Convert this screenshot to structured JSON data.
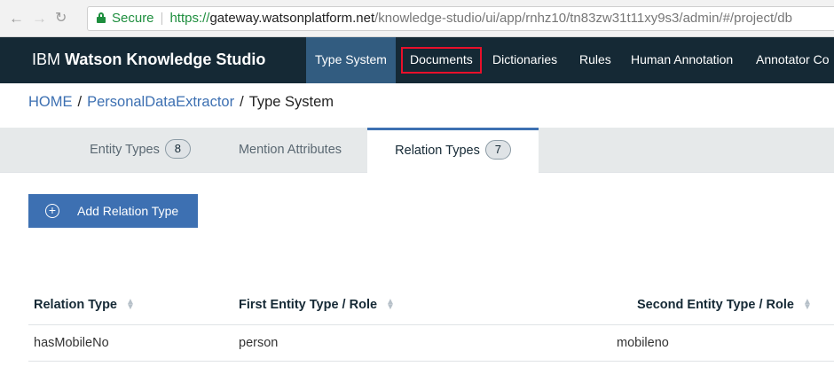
{
  "browser": {
    "secure_label": "Secure",
    "url_protocol": "https://",
    "url_host": "gateway.watsonplatform.net",
    "url_path": "/knowledge-studio/ui/app/rnhz10/tn83zw31t11xy9s3/admin/#/project/db"
  },
  "header": {
    "brand_prefix": "IBM ",
    "brand_name": "Watson Knowledge Studio",
    "nav": [
      "Type System",
      "Documents",
      "Dictionaries",
      "Rules",
      "Human Annotation",
      "Annotator Co"
    ]
  },
  "breadcrumb": {
    "home": "HOME",
    "project": "PersonalDataExtractor",
    "current": "Type System",
    "separator": "/"
  },
  "tabs": [
    {
      "label": "Entity Types",
      "count": "8"
    },
    {
      "label": "Mention Attributes"
    },
    {
      "label": "Relation Types",
      "count": "7"
    }
  ],
  "add_button": {
    "label": "Add Relation Type"
  },
  "table": {
    "headers": [
      "Relation Type",
      "First Entity Type / Role",
      "Second Entity Type / Role"
    ],
    "rows": [
      [
        "hasMobileNo",
        "person",
        "mobileno"
      ]
    ]
  },
  "colors": {
    "header_bg": "#152935",
    "active_nav": "#325c80",
    "highlight_box": "#e8102a",
    "primary_button": "#3d70b2",
    "link": "#3d70b2"
  }
}
